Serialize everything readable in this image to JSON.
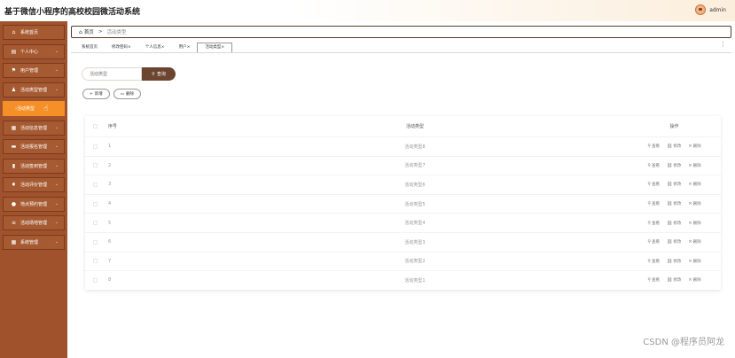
{
  "header": {
    "title": "基于微信小程序的高校校园微活动系统",
    "username": "admin"
  },
  "sidebar": {
    "items": [
      {
        "label": "系统首页",
        "icon": "home-icon",
        "glyph": "⌂"
      },
      {
        "label": "个人中心",
        "icon": "profile-icon",
        "glyph": "▤"
      },
      {
        "label": "用户管理",
        "icon": "flag-icon",
        "glyph": "⚑"
      },
      {
        "label": "活动类型管理",
        "icon": "user-icon",
        "glyph": "♟"
      },
      {
        "label": "活动类型",
        "icon": "chevron-right-icon",
        "glyph": "›",
        "active": true
      },
      {
        "label": "活动信息管理",
        "icon": "grid-icon",
        "glyph": "▦"
      },
      {
        "label": "活动报名管理",
        "icon": "card-icon",
        "glyph": "▬"
      },
      {
        "label": "活动签到管理",
        "icon": "chart-icon",
        "glyph": "▮"
      },
      {
        "label": "活动评价管理",
        "icon": "pin-icon",
        "glyph": "♦"
      },
      {
        "label": "地点预约管理",
        "icon": "location-icon",
        "glyph": "●"
      },
      {
        "label": "活动场地管理",
        "icon": "list-icon",
        "glyph": "≡"
      },
      {
        "label": "系统管理",
        "icon": "grid-icon",
        "glyph": "▦"
      }
    ]
  },
  "breadcrumb": {
    "home": "首页",
    "separator": ">",
    "current": "活动类型"
  },
  "tabs": [
    {
      "label": "系统首页",
      "closable": false
    },
    {
      "label": "修改密码",
      "closable": true
    },
    {
      "label": "个人信息",
      "closable": true
    },
    {
      "label": "用户",
      "closable": true
    },
    {
      "label": "活动类型",
      "closable": true,
      "current": true
    }
  ],
  "search": {
    "placeholder": "活动类型",
    "button_label": "查询"
  },
  "actions": {
    "add_label": "新增",
    "delete_label": "删除"
  },
  "table": {
    "headers": {
      "index": "序号",
      "type": "活动类型",
      "ops": "操作"
    },
    "op_labels": {
      "view": "查看",
      "edit": "修改",
      "delete": "删除"
    },
    "rows": [
      {
        "index": "1",
        "type": "活动类型8"
      },
      {
        "index": "2",
        "type": "活动类型7"
      },
      {
        "index": "3",
        "type": "活动类型6"
      },
      {
        "index": "4",
        "type": "活动类型5"
      },
      {
        "index": "5",
        "type": "活动类型4"
      },
      {
        "index": "6",
        "type": "活动类型3"
      },
      {
        "index": "7",
        "type": "活动类型2"
      },
      {
        "index": "8",
        "type": "活动类型1"
      }
    ]
  },
  "watermark": "CSDN @程序员阿龙",
  "colors": {
    "sidebar": "#a0522d",
    "active_item": "#ff8c1a",
    "search_button": "#6b4530"
  }
}
